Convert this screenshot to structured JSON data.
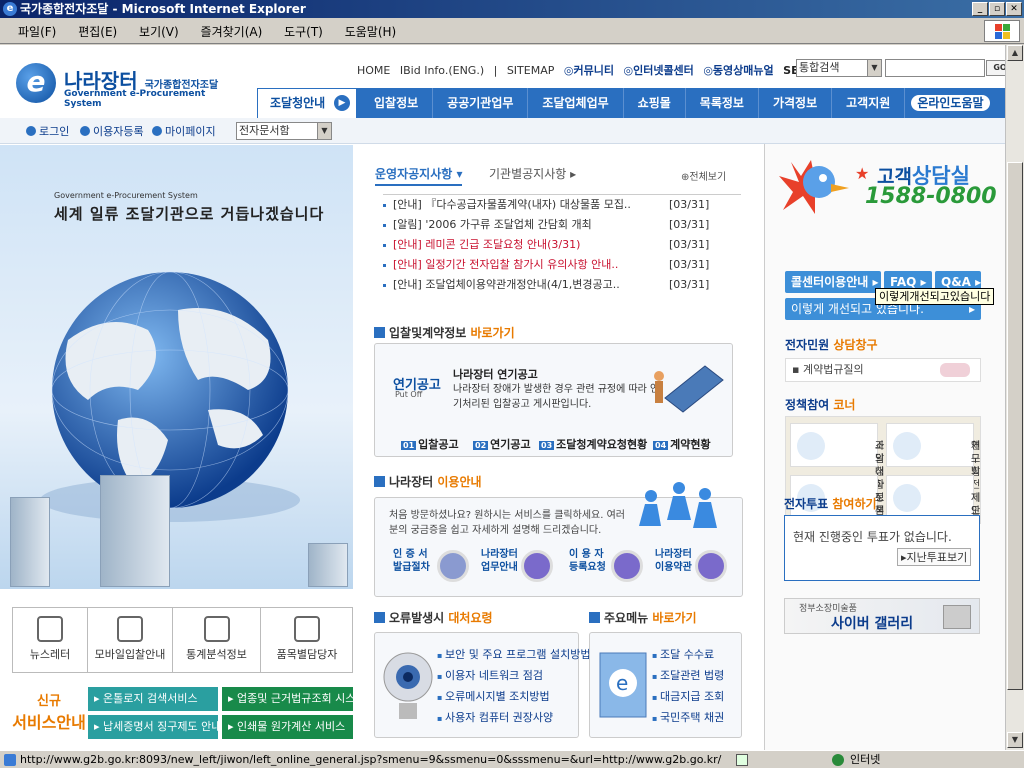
{
  "window": {
    "title": "국가종합전자조달 - Microsoft Internet Explorer",
    "min": "_",
    "max": "▫",
    "close": "✕"
  },
  "menubar": [
    "파일(F)",
    "편집(E)",
    "보기(V)",
    "즐겨찾기(A)",
    "도구(T)",
    "도움말(H)"
  ],
  "header": {
    "logo_name": "나라장터",
    "logo_sub": "국가종합전자조달",
    "logo_en": "Government e-Procurement System",
    "top_links": [
      "HOME",
      "IBid Info.(ENG.)",
      "|",
      "SITEMAP"
    ],
    "top_icon_links": [
      "커뮤니티",
      "인터넷콜센터",
      "동영상매뉴얼"
    ],
    "search_label": "SEARCH",
    "search_scope": "통합검색",
    "search_button": "GO"
  },
  "nav": {
    "home": "조달청안내",
    "items": [
      "입찰정보",
      "공공기관업무",
      "조달업체업무",
      "쇼핑몰",
      "목록정보",
      "가격정보",
      "고객지원"
    ],
    "help": "온라인도움말"
  },
  "subbar": {
    "login": "로그인",
    "register": "이용자등록",
    "mypage": "마이페이지",
    "doc_select": "전자문서함"
  },
  "hero": {
    "sub": "Government e-Procurement System",
    "title": "세계 일류 조달기관으로 거듭나겠습니다"
  },
  "quick": [
    "뉴스레터",
    "모바일입찰안내",
    "통계분석정보",
    "품목별담당자"
  ],
  "services": {
    "label_a": "신규",
    "label_b": "서비스안내",
    "items": [
      "온톨로지 검색서비스",
      "업종및 근거법규조회 시스템",
      "납세증명서 징구제도 안내",
      "인쇄물 원가계산 서비스"
    ]
  },
  "notice": {
    "tab_active": "운영자공지사항",
    "tab_other": "기관별공지사항",
    "more": "전체보기",
    "rows": [
      {
        "title": "[안내] 『다수공급자물품계약(내자) 대상물품 모집..",
        "date": "[03/31]",
        "red": false
      },
      {
        "title": "[알림] '2006 가구류 조달업체 간담회 개최",
        "date": "[03/31]",
        "red": false
      },
      {
        "title": "[안내] 레미콘 긴급 조달요청 안내(3/31)",
        "date": "[03/31]",
        "red": true
      },
      {
        "title": "[안내] 일정기간 전자입찰 참가시 유의사항 안내..",
        "date": "[03/31]",
        "red": true
      },
      {
        "title": "[안내] 조달업체이용약관개정안내(4/1,변경공고..",
        "date": "[03/31]",
        "red": false
      }
    ]
  },
  "bid": {
    "head_a": "입찰및계약정보",
    "head_b": "바로가기",
    "label": "연기공고",
    "label_en": "Put Off",
    "title": "나라장터 연기공고",
    "desc": "나라장터 장애가 발생한 경우 관련 규정에 따라 연기처리된 입찰공고 게시판입니다.",
    "links": [
      {
        "num": "01",
        "text": "입찰공고"
      },
      {
        "num": "02",
        "text": "연기공고"
      },
      {
        "num": "03",
        "text": "조달청계약요청현황"
      },
      {
        "num": "04",
        "text": "계약현황"
      }
    ]
  },
  "guide": {
    "head_a": "나라장터",
    "head_b": "이용안내",
    "desc": "처음 방문하셨나요? 원하시는 서비스를 클릭하세요. 여러분의 궁금증을 쉽고 자세하게 설명해 드리겠습니다.",
    "items": [
      {
        "l1": "인 증 서",
        "l2": "발급절차"
      },
      {
        "l1": "나라장터",
        "l2": "업무안내"
      },
      {
        "l1": "이 용 자",
        "l2": "등록요청"
      },
      {
        "l1": "나라장터",
        "l2": "이용약관"
      }
    ]
  },
  "errors": {
    "head_a": "오류발생시",
    "head_b": "대처요령",
    "items": [
      "보안 및 주요 프로그램 설치방법",
      "이용자 네트워크 점검",
      "오류메시지별 조치방법",
      "사용자 컴퓨터 권장사양"
    ]
  },
  "menus": {
    "head_a": "주요메뉴",
    "head_b": "바로가기",
    "items": [
      "조달 수수료",
      "조달관련 법령",
      "대금지급 조회",
      "국민주택 채권"
    ]
  },
  "counsel": {
    "title_a": "고객",
    "title_b": "상담실",
    "phone": "1588-0800",
    "btn_center": "콜센터이용안내",
    "btn_faq": "FAQ",
    "btn_qa": "Q&A",
    "btn_improve": "이렇게 개선되고 있습니다."
  },
  "tooltip": "이렇게개선되고있습니다",
  "petition": {
    "head_a": "전자민원",
    "head_b": "상담창구",
    "item": "계약법규질의"
  },
  "policy": {
    "head_a": "정책참여",
    "head_b": "코너",
    "cells": [
      {
        "l1": "조달청장",
        "l2": "과의대화"
      },
      {
        "l1": "제도발전",
        "l2": "연 구 회"
      },
      {
        "l1": "정   책",
        "l2": "토론방"
      },
      {
        "l1": "제도개선",
        "l2": "제안마당"
      }
    ]
  },
  "vote": {
    "head_a": "전자투표",
    "head_b": "참여하기",
    "empty": "현재 진행중인 투표가 없습니다.",
    "past": "지난투표보기"
  },
  "gallery": {
    "sub": "정부소장미술품",
    "title": "사이버 갤러리"
  },
  "status": {
    "url": "http://www.g2b.go.kr:8093/new_left/jiwon/left_online_general.jsp?smenu=9&ssmenu=0&sssmenu=&url=http://www.g2b.go.kr/",
    "zone": "인터넷"
  }
}
